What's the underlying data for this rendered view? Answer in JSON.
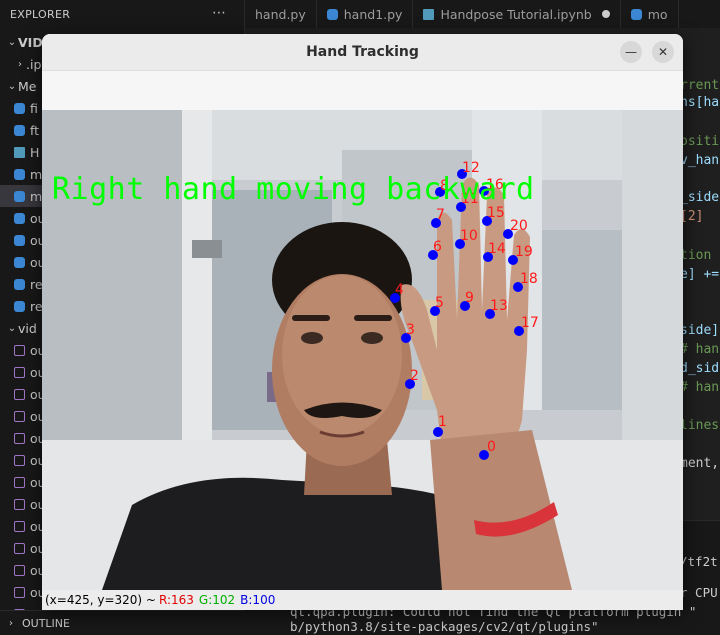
{
  "vscode": {
    "explorer_title": "EXPLORER",
    "tree": [
      {
        "label": "VID_C",
        "kind": "folder",
        "open": true
      },
      {
        "label": ".ipy",
        "kind": "folder",
        "open": false
      },
      {
        "label": "Me",
        "kind": "folder",
        "open": true
      },
      {
        "label": "fi",
        "kind": "py"
      },
      {
        "label": "ft",
        "kind": "py"
      },
      {
        "label": "H",
        "kind": "nb"
      },
      {
        "label": "m",
        "kind": "py"
      },
      {
        "label": "m",
        "kind": "py",
        "selected": true
      },
      {
        "label": "ou",
        "kind": "py"
      },
      {
        "label": "ou",
        "kind": "py"
      },
      {
        "label": "ou",
        "kind": "py"
      },
      {
        "label": "re",
        "kind": "py"
      },
      {
        "label": "re",
        "kind": "py"
      },
      {
        "label": "vid",
        "kind": "folder",
        "open": true
      },
      {
        "label": "ou",
        "kind": "vid"
      },
      {
        "label": "ou",
        "kind": "vid"
      },
      {
        "label": "ou",
        "kind": "vid"
      },
      {
        "label": "ou",
        "kind": "vid"
      },
      {
        "label": "ou",
        "kind": "vid"
      },
      {
        "label": "ou",
        "kind": "vid"
      },
      {
        "label": "ou",
        "kind": "vid"
      },
      {
        "label": "ou",
        "kind": "vid"
      },
      {
        "label": "ou",
        "kind": "vid"
      },
      {
        "label": "ou",
        "kind": "vid"
      },
      {
        "label": "ou",
        "kind": "vid"
      },
      {
        "label": "ou",
        "kind": "vid"
      },
      {
        "label": "ou",
        "kind": "vid"
      }
    ],
    "outline_label": "OUTLINE",
    "tabs": [
      {
        "label": "hand.py"
      },
      {
        "label": "hand1.py"
      },
      {
        "label": "Handpose Tutorial.ipynb",
        "modified": true
      },
      {
        "label": "mo"
      }
    ],
    "code_fragments": [
      {
        "text": "rrent",
        "color": "#6a9955"
      },
      {
        "text": "ns[ha",
        "color": "#9cdcfe"
      },
      {
        "text": "ositi",
        "color": "#6a9955"
      },
      {
        "text": "v_han",
        "color": "#9cdcfe"
      },
      {
        "text": "_side",
        "color": "#9cdcfe"
      },
      {
        "text": "[2]",
        "color": "#ce9178"
      },
      {
        "text": "tion",
        "color": "#6a9955"
      },
      {
        "text": "e] +=",
        "color": "#9cdcfe"
      },
      {
        "text": "side]",
        "color": "#9cdcfe"
      },
      {
        "text": "# han",
        "color": "#6a9955"
      },
      {
        "text": "d_sid",
        "color": "#9cdcfe"
      },
      {
        "text": "# han",
        "color": "#6a9955"
      },
      {
        "text": "lines",
        "color": "#6a9955"
      },
      {
        "text": "ment,",
        "color": "#cccccc"
      }
    ],
    "terminal_lines": [
      "/tf2t",
      "r CPU",
      "qt.qpa.plugin: Could not find the Qt platform plugin \"",
      "b/python3.8/site-packages/cv2/qt/plugins\""
    ]
  },
  "window": {
    "title": "Hand Tracking",
    "minimize_icon": "minus-icon",
    "close_icon": "close-icon"
  },
  "overlay": {
    "text": "Right hand moving backward",
    "text_color": "#00ff00",
    "landmark_color": "#0000ff",
    "label_color": "#ff1a1a",
    "landmarks": [
      "0",
      "1",
      "2",
      "3",
      "4",
      "5",
      "6",
      "7",
      "8",
      "9",
      "10",
      "11",
      "12",
      "13",
      "14",
      "15",
      "16",
      "17",
      "18",
      "19",
      "20"
    ]
  },
  "statusbar": {
    "coords": "(x=425, y=320) ~",
    "r": "R:163",
    "g": "G:102",
    "b": "B:100"
  }
}
